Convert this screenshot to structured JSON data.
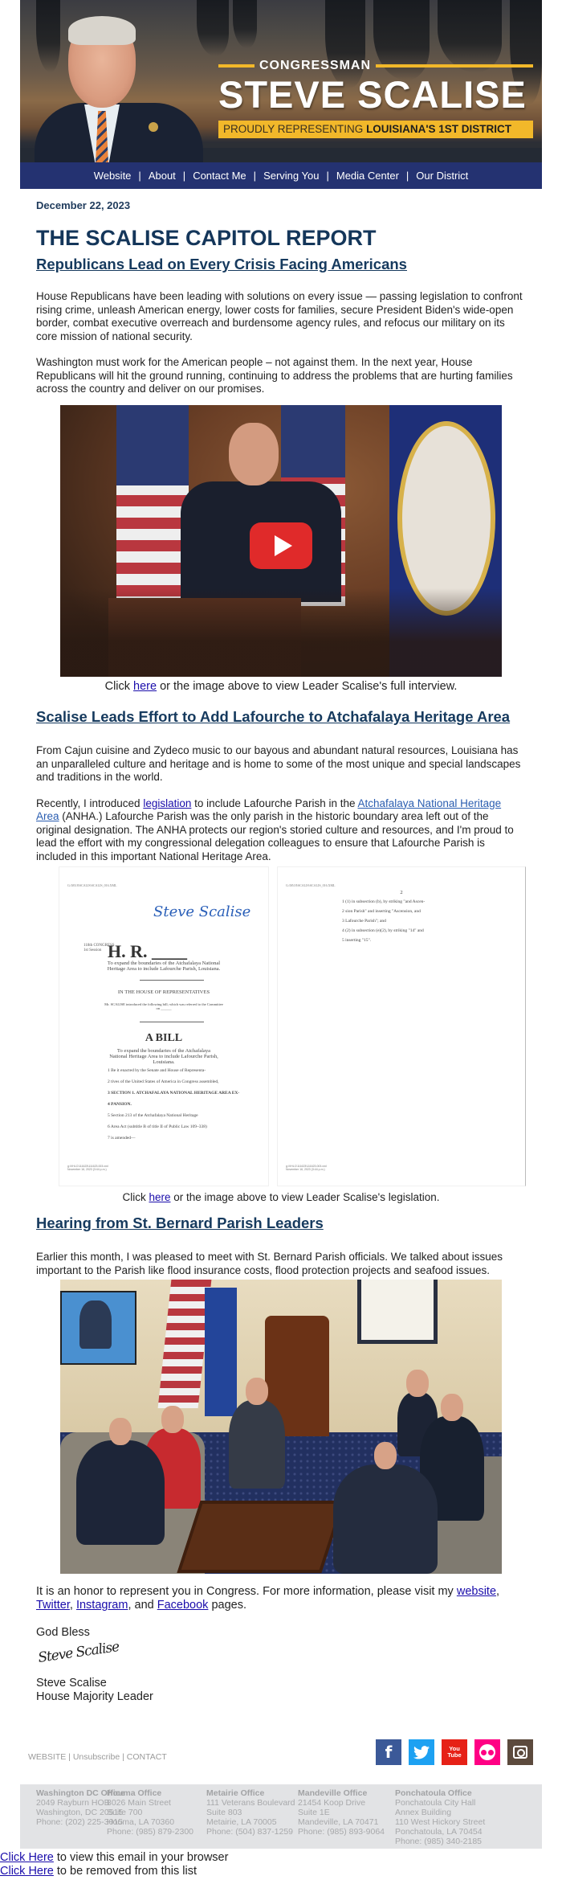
{
  "banner": {
    "congressman_label": "CONGRESSMAN",
    "name": "STEVE SCALISE",
    "tagline_prefix": "PROUDLY REPRESENTING",
    "tagline_bold": "LOUISIANA'S 1ST DISTRICT",
    "accent_color": "#f2b82a"
  },
  "nav": {
    "color": "#243271",
    "items": [
      {
        "label": "Website"
      },
      {
        "label": "About"
      },
      {
        "label": "Contact Me"
      },
      {
        "label": "Serving You"
      },
      {
        "label": "Media Center"
      },
      {
        "label": "Our District"
      }
    ],
    "separator": "|"
  },
  "date": "December 22, 2023",
  "report_title": "THE SCALISE CAPITOL REPORT",
  "sections": [
    {
      "heading": "Republicans Lead on Every Crisis Facing Americans",
      "paragraphs": [
        "House Republicans have been leading with solutions on every issue — passing legislation to confront rising crime, unleash American energy, lower costs for families, secure President Biden's wide-open border, combat executive overreach and burdensome agency rules, and refocus our military on its core mission of national security.",
        "Washington must work for the American people – not against them. In the next year, House Republicans will hit the ground running, continuing to address the problems that are hurting families across the country and deliver on our promises."
      ],
      "media": {
        "type": "video-thumbnail",
        "icon": "play-button-icon"
      },
      "caption": {
        "before": "Click ",
        "link": "here",
        "after": " or the image above to view Leader Scalise's full interview."
      }
    },
    {
      "heading": "Scalise Leads Effort to Add Lafourche to Atchafalaya Heritage Area",
      "paragraphs": [
        "From Cajun cuisine and Zydeco music to our bayous and abundant natural resources, Louisiana has an unparalleled culture and heritage and is home to some of the most unique and special landscapes and traditions in the world."
      ],
      "p2": {
        "t1": "Recently, I introduced ",
        "link1": "legislation",
        "t2": " to include Lafourche Parish in the ",
        "link2": "Atchafalaya National Heritage Area",
        "t3": " (ANHA.) Lafourche Parish was the only parish in the historic boundary area left out of the original designation. The ANHA protects our region's storied culture and resources, and I'm proud to lead the effort with my congressional delegation colleagues to ensure that Lafourche Parish is included in this important National Heritage Area."
      },
      "bill": {
        "page1": {
          "signature": "Steve Scalise",
          "congress": "118th CONGRESS",
          "session": "1st Session",
          "hr": "H. R. ____",
          "short_title": "To expand the boundaries of the Atchafalaya National Heritage Area to include Lafourche Parish, Louisiana.",
          "in_house": "IN THE HOUSE OF REPRESENTATIVES",
          "intro": "Mr. SCALISE introduced the following bill; which was referred to the Committee on ______",
          "a_bill": "A BILL",
          "long_title": "To expand the boundaries of the Atchafalaya National Heritage Area to include Lafourche Parish, Louisiana.",
          "lines": [
            "1   Be it enacted by the Senate and House of Representa-",
            "2 tives of the United States of America in Congress assembled,",
            "3 SECTION 1. ATCHAFALAYA NATIONAL HERITAGE AREA EX-",
            "4           PANSION.",
            "5   Section 213 of the Atchafalaya National Heritage",
            "6 Area Act (subtitle B of title II of Public Law 109–338)",
            "7 is amended—"
          ]
        },
        "page2": {
          "page_number": "2",
          "lines": [
            "1     (1) in subsection (b), by striking \"and Ascen-",
            "2   sion Parish\" and inserting \"Ascension, and",
            "3   Lafourche Parish\"; and",
            "4     (2) in subsection (e)(2), by striking \"14\" and",
            "5   inserting \"15\"."
          ]
        }
      },
      "caption": {
        "before": "Click ",
        "link": "here",
        "after": " or the image above to view Leader Scalise's legislation."
      }
    },
    {
      "heading": "Hearing from St. Bernard Parish Leaders",
      "paragraphs": [
        "Earlier this month, I was pleased to meet with St. Bernard Parish officials. We talked about issues important to the Parish like flood insurance costs, flood protection projects and seafood issues."
      ],
      "media": {
        "type": "photo",
        "description": "meeting-photo"
      }
    }
  ],
  "closing": {
    "t1": "It is an honor to represent you in Congress. For more information, please visit my ",
    "links": [
      "website",
      "Twitter",
      "Instagram",
      "Facebook"
    ],
    "sep1": ", ",
    "sep2": ", ",
    "sep3": ", and ",
    "t2": " pages.",
    "blessing": "God Bless",
    "signature": "Steve Scalise",
    "name": "Steve Scalise",
    "role": "House Majority Leader"
  },
  "footer": {
    "links": [
      "WEBSITE",
      "Unsubscribe",
      "CONTACT"
    ],
    "separator": " | ",
    "social": [
      {
        "name": "facebook",
        "glyph": "f",
        "color": "#3b5998"
      },
      {
        "name": "twitter",
        "glyph": "🐦",
        "color": "#1da1f2"
      },
      {
        "name": "youtube",
        "glyph_top": "You",
        "glyph_bottom": "Tube",
        "color": "#e62117"
      },
      {
        "name": "flickr",
        "color": "#ff0084"
      },
      {
        "name": "instagram",
        "color": "#5c4a3d"
      }
    ],
    "offices": [
      {
        "name": "Washington DC Office",
        "lines": [
          "2049 Rayburn HOB",
          "Washington, DC 20515",
          "Phone: (202) 225-3015"
        ]
      },
      {
        "name": "Houma Office",
        "lines": [
          "8026 Main Street",
          "Suite 700",
          "Houma, LA 70360",
          "Phone: (985) 879-2300"
        ]
      },
      {
        "name": "Metairie Office",
        "lines": [
          "111 Veterans Boulevard",
          "Suite 803",
          "Metairie, LA 70005",
          "Phone: (504) 837-1259"
        ]
      },
      {
        "name": "Mandeville Office",
        "lines": [
          "21454 Koop Drive",
          "Suite 1E",
          "Mandeville, LA 70471",
          "Phone: (985) 893-9064"
        ]
      },
      {
        "name": "Ponchatoula Office",
        "lines": [
          "Ponchatoula City Hall",
          "Annex Building",
          "110 West Hickory Street",
          "Ponchatoula, LA 70454",
          "Phone: (985) 340-2185"
        ]
      }
    ],
    "view_browser": {
      "link": "Click Here",
      "text": " to view this email in your browser"
    },
    "remove": {
      "link": "Click Here",
      "text": " to be removed from this list"
    }
  }
}
